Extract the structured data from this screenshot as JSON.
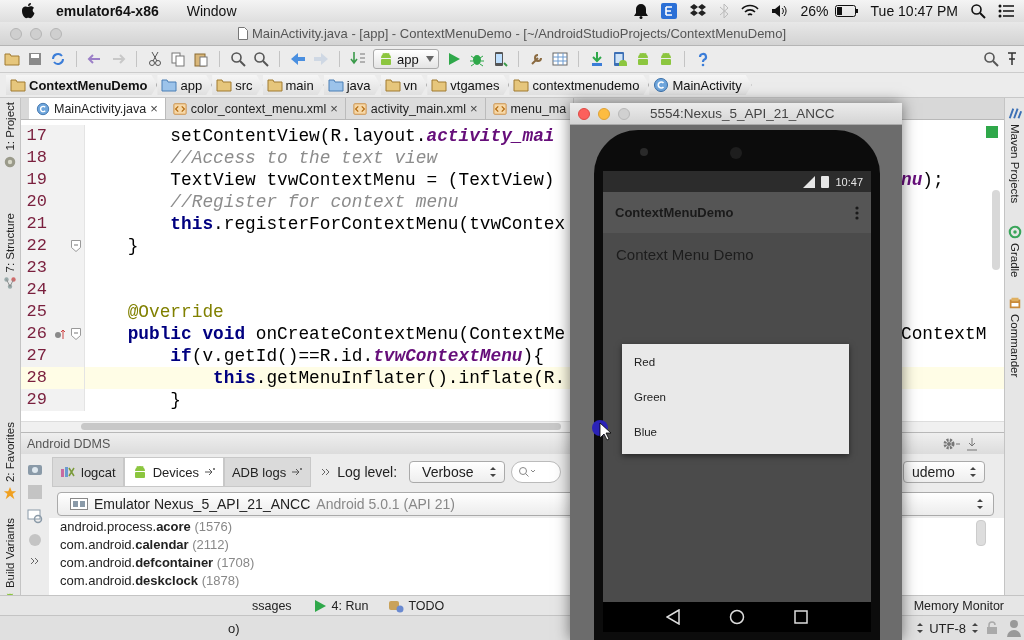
{
  "menubar": {
    "app_name": "emulator64-x86",
    "menus": [
      "Window"
    ],
    "battery": "26%",
    "clock": "Tue 10:47 PM"
  },
  "window": {
    "title": "MainActivity.java - [app] - ContextMenuDemo - [~/AndroidStudioProjects/ContextMenuDemo]"
  },
  "toolbar": {
    "run_config": "app"
  },
  "breadcrumbs": [
    {
      "label": "ContextMenuDemo",
      "kind": "project"
    },
    {
      "label": "app",
      "kind": "module"
    },
    {
      "label": "src",
      "kind": "folder"
    },
    {
      "label": "main",
      "kind": "folder"
    },
    {
      "label": "java",
      "kind": "source"
    },
    {
      "label": "vn",
      "kind": "folder"
    },
    {
      "label": "vtgames",
      "kind": "folder"
    },
    {
      "label": "contextmenudemo",
      "kind": "folder"
    },
    {
      "label": "MainActivity",
      "kind": "class"
    }
  ],
  "left_stripe": [
    {
      "label": "1: Project",
      "kind": "project"
    },
    {
      "label": "7: Structure",
      "kind": "structure"
    },
    {
      "label": "2: Favorites",
      "kind": "favorites"
    },
    {
      "label": "Build Variants",
      "kind": "variants"
    }
  ],
  "right_stripe": [
    {
      "label": "Maven Projects",
      "kind": "maven"
    },
    {
      "label": "Gradle",
      "kind": "gradle"
    },
    {
      "label": "Commander",
      "kind": "commander"
    }
  ],
  "editor_tabs": [
    {
      "label": "MainActivity.java",
      "kind": "java",
      "selected": true,
      "close": "×"
    },
    {
      "label": "color_context_menu.xml",
      "kind": "xml",
      "selected": false,
      "close": "×"
    },
    {
      "label": "activity_main.xml",
      "kind": "xml",
      "selected": false,
      "close": "×"
    },
    {
      "label": "menu_ma",
      "kind": "xml",
      "selected": false
    }
  ],
  "editor": {
    "lines": [
      {
        "number": "17",
        "current": false,
        "fold": false,
        "overrides": false,
        "tokens": [
          {
            "kind": "plain",
            "text": "        setContentView(R.layout."
          },
          {
            "kind": "field",
            "text": "activity_mai"
          }
        ]
      },
      {
        "number": "18",
        "current": false,
        "fold": false,
        "overrides": false,
        "tokens": [
          {
            "kind": "comment",
            "text": "        //Access to the text view"
          }
        ]
      },
      {
        "number": "19",
        "current": false,
        "fold": false,
        "overrides": false,
        "tokens": [
          {
            "kind": "plain",
            "text": "        TextView tvwContextMenu = (TextView)"
          }
        ],
        "right": [
          {
            "kind": "field",
            "text": "nu"
          },
          {
            "kind": "plain",
            "text": ");"
          }
        ]
      },
      {
        "number": "20",
        "current": false,
        "fold": false,
        "overrides": false,
        "tokens": [
          {
            "kind": "comment",
            "text": "        //Register for context menu"
          }
        ]
      },
      {
        "number": "21",
        "current": false,
        "fold": false,
        "overrides": false,
        "tokens": [
          {
            "kind": "keyword",
            "text": "        this"
          },
          {
            "kind": "plain",
            "text": ".registerForContextMenu(tvwContex"
          }
        ]
      },
      {
        "number": "22",
        "current": false,
        "fold": true,
        "overrides": false,
        "tokens": [
          {
            "kind": "plain",
            "text": "    }"
          }
        ]
      },
      {
        "number": "23",
        "current": false,
        "fold": false,
        "overrides": false
      },
      {
        "number": "24",
        "current": false,
        "fold": false,
        "overrides": false
      },
      {
        "number": "25",
        "current": false,
        "fold": false,
        "overrides": false,
        "tokens": [
          {
            "kind": "annotation",
            "text": "    @Override"
          }
        ]
      },
      {
        "number": "26",
        "current": false,
        "fold": true,
        "overrides": true,
        "tokens": [
          {
            "kind": "keyword",
            "text": "    public void"
          },
          {
            "kind": "plain",
            "text": " onCreateContextMenu(ContextMe"
          }
        ],
        "right": [
          {
            "kind": "plain",
            "text": "ContextM"
          }
        ]
      },
      {
        "number": "27",
        "current": false,
        "fold": false,
        "overrides": false,
        "tokens": [
          {
            "kind": "keyword",
            "text": "        if"
          },
          {
            "kind": "plain",
            "text": "(v.getId()==R.id."
          },
          {
            "kind": "field",
            "text": "tvwContextMenu"
          },
          {
            "kind": "plain",
            "text": "){"
          }
        ]
      },
      {
        "number": "28",
        "current": true,
        "fold": false,
        "overrides": false,
        "tokens": [
          {
            "kind": "keyword",
            "text": "            this"
          },
          {
            "kind": "plain",
            "text": ".getMenuInflater().inflate(R."
          }
        ]
      },
      {
        "number": "29",
        "current": false,
        "fold": false,
        "overrides": false,
        "tokens": [
          {
            "kind": "plain",
            "text": "        }"
          }
        ]
      }
    ]
  },
  "ddms": {
    "title": "Android DDMS",
    "tabs": [
      {
        "label": "logcat",
        "kind": "logcat",
        "selected": false,
        "pinned": false
      },
      {
        "label": "Devices",
        "kind": "devices",
        "selected": true,
        "pinned": true
      },
      {
        "label": "ADB logs",
        "kind": "adb",
        "selected": false,
        "pinned": true
      }
    ],
    "log_level_label": "Log level:",
    "log_level": "Verbose",
    "package_select": "udemo",
    "device": {
      "name": "Emulator Nexus_5_API_21_ANCC",
      "version": "Android 5.0.1 (API 21)"
    },
    "processes": [
      {
        "package": "android.process.",
        "name": "acore",
        "pid": "(1576)"
      },
      {
        "package": "com.android.",
        "name": "calendar",
        "pid": "(2112)"
      },
      {
        "package": "com.android.",
        "name": "defcontainer",
        "pid": "(1708)"
      },
      {
        "package": "com.android.",
        "name": "deskclock",
        "pid": "(1878)"
      }
    ]
  },
  "tool_buttons": [
    {
      "label": "ssages",
      "kind": "messages"
    },
    {
      "label": "4: Run",
      "kind": "run"
    },
    {
      "label": "TODO",
      "kind": "todo"
    }
  ],
  "tool_buttons_right": [
    {
      "label": "Memory Monitor"
    }
  ],
  "status_bar": {
    "left": "o)",
    "encoding": "UTF-8"
  },
  "emulator": {
    "title": "5554:Nexus_5_API_21_ANCC",
    "clock": "10:47",
    "app_title": "ContextMenuDemo",
    "content_text": "Context Menu Demo",
    "context_menu": [
      "Red",
      "Green",
      "Blue"
    ]
  }
}
